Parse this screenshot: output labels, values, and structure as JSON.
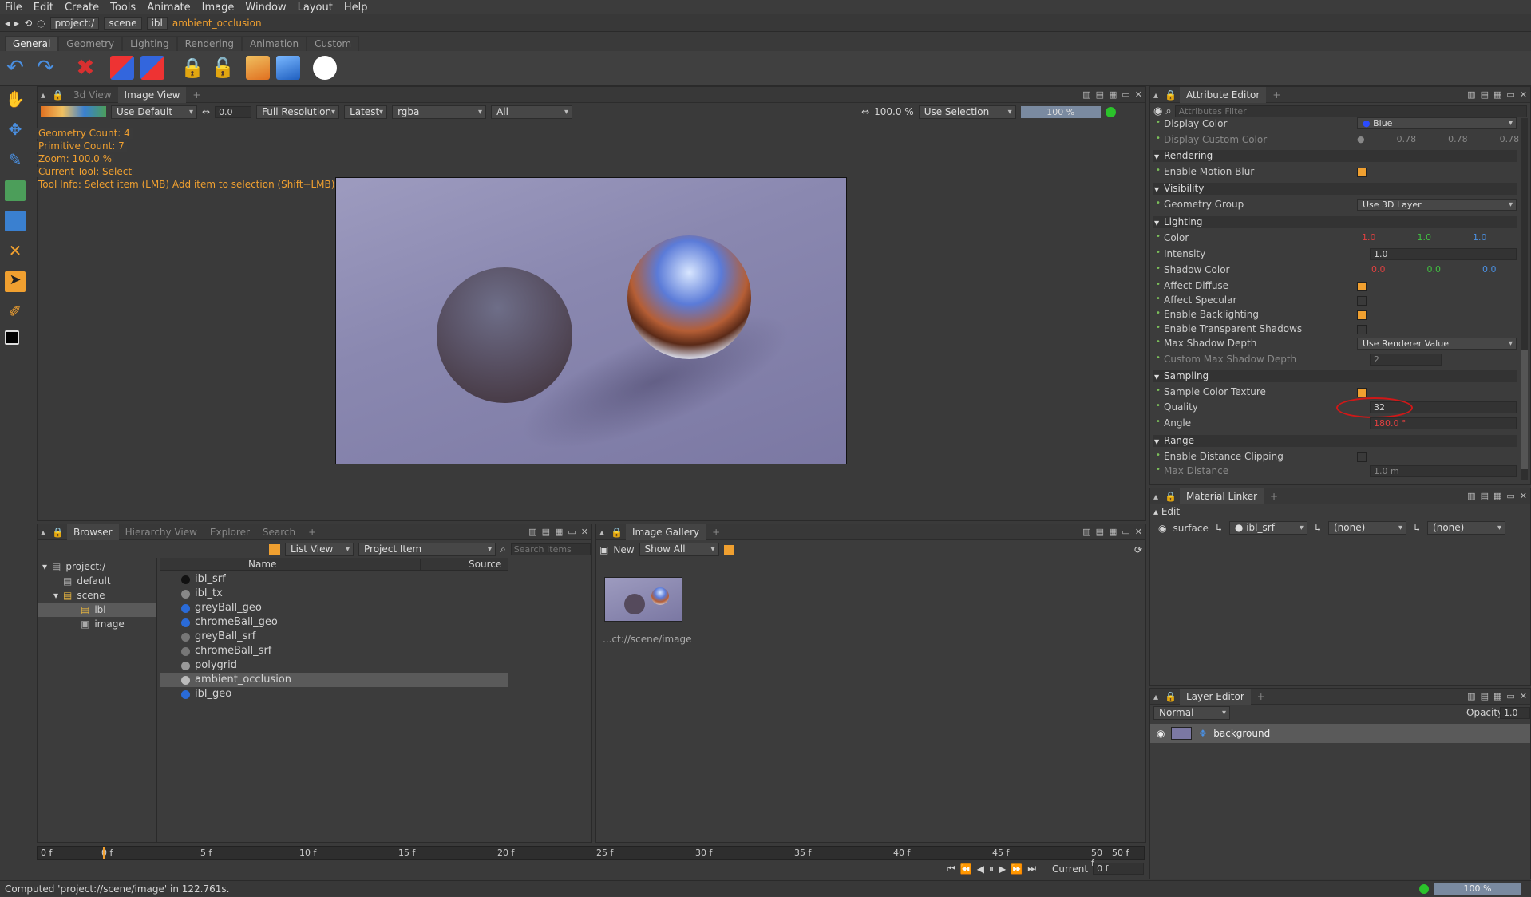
{
  "menu": [
    "File",
    "Edit",
    "Create",
    "Tools",
    "Animate",
    "Image",
    "Window",
    "Layout",
    "Help"
  ],
  "address": {
    "crumbs": [
      "project:/",
      "scene",
      "ibl"
    ],
    "current": "ambient_occlusion"
  },
  "shelf_tabs": [
    {
      "label": "General",
      "active": true
    },
    {
      "label": "Geometry"
    },
    {
      "label": "Lighting"
    },
    {
      "label": "Rendering"
    },
    {
      "label": "Animation"
    },
    {
      "label": "Custom"
    }
  ],
  "viewer": {
    "tabs": [
      "3d View",
      "Image View"
    ],
    "active_tab": "Image View",
    "display": "Use Default",
    "exposure": "0.0",
    "resolution": "Full Resolution",
    "version": "Latest",
    "channels": "rgba",
    "layer": "All",
    "zoom": "100.0 %",
    "selection": "Use Selection",
    "progress": "100 %",
    "progress_value": 100,
    "overlay": [
      "Geometry Count: 4",
      "Primitive Count: 7",
      "Zoom: 100.0 %",
      "Current Tool: Select",
      "Tool Info: Select item (LMB)  Add item to selection (Shift+LMB)  Toggle item selection (Ctrl+LMB)  Selection rect (LMB-Drag)"
    ]
  },
  "attribute_editor": {
    "title": "Attribute Editor",
    "filter_placeholder": "Attributes Filter",
    "display_color": {
      "label": "Display Color",
      "value": "Blue"
    },
    "display_custom_color": {
      "label": "Display Custom Color",
      "values": [
        "0.78",
        "0.78",
        "0.78"
      ]
    },
    "sections": {
      "rendering": "Rendering",
      "visibility": "Visibility",
      "lighting": "Lighting",
      "sampling": "Sampling",
      "range": "Range"
    },
    "enable_motion_blur": "Enable Motion Blur",
    "geometry_group": {
      "label": "Geometry Group",
      "value": "Use 3D Layer"
    },
    "color": {
      "label": "Color",
      "values": [
        "1.0",
        "1.0",
        "1.0"
      ]
    },
    "intensity": {
      "label": "Intensity",
      "value": "1.0"
    },
    "shadow_color": {
      "label": "Shadow Color",
      "values": [
        "0.0",
        "0.0",
        "0.0"
      ]
    },
    "affect_diffuse": "Affect Diffuse",
    "affect_specular": "Affect Specular",
    "enable_backlighting": "Enable Backlighting",
    "enable_transparent_shadows": "Enable Transparent Shadows",
    "max_shadow_depth": {
      "label": "Max Shadow Depth",
      "value": "Use Renderer Value"
    },
    "custom_max_shadow_depth": {
      "label": "Custom Max Shadow Depth",
      "value": "2"
    },
    "sample_color_texture": "Sample Color Texture",
    "quality": {
      "label": "Quality",
      "value": "32"
    },
    "angle": {
      "label": "Angle",
      "value": "180.0 °"
    },
    "enable_distance_clipping": "Enable Distance Clipping",
    "max_distance": {
      "label": "Max Distance",
      "value": "1.0 m"
    }
  },
  "material_linker": {
    "title": "Material Linker",
    "edit": "Edit",
    "surface": "surface",
    "material": "ibl_srf",
    "slot2": "(none)",
    "slot3": "(none)"
  },
  "layer_editor": {
    "title": "Layer Editor",
    "blend": "Normal",
    "opacity_label": "Opacity",
    "opacity": "1.0",
    "layer": "background"
  },
  "browser": {
    "tabs": [
      "Browser",
      "Hierarchy View",
      "Explorer",
      "Search"
    ],
    "view": "List View",
    "filter": "Project Item",
    "search_placeholder": "Search Items",
    "tree": [
      "project:/",
      "default",
      "scene",
      "ibl",
      "image"
    ],
    "columns": [
      "Name",
      "Source"
    ],
    "items": [
      {
        "name": "ibl_srf",
        "color": "#111111"
      },
      {
        "name": "ibl_tx",
        "color": "#888888"
      },
      {
        "name": "greyBall_geo",
        "color": "#2a6bd8"
      },
      {
        "name": "chromeBall_geo",
        "color": "#2a6bd8"
      },
      {
        "name": "greyBall_srf",
        "color": "#777777"
      },
      {
        "name": "chromeBall_srf",
        "color": "#777777"
      },
      {
        "name": "polygrid",
        "color": "#999999"
      },
      {
        "name": "ambient_occlusion",
        "color": "#bbbbbb"
      },
      {
        "name": "ibl_geo",
        "color": "#2a6bd8"
      }
    ]
  },
  "gallery": {
    "title": "Image Gallery",
    "new": "New",
    "filter": "Show All",
    "caption": "...ct://scene/image"
  },
  "timeline": {
    "start": "0 f",
    "ticks": [
      "0 f",
      "5 f",
      "10 f",
      "15 f",
      "20 f",
      "25 f",
      "30 f",
      "35 f",
      "40 f",
      "45 f",
      "50 f"
    ],
    "end": "50 f",
    "current_label": "Current",
    "current": "0 f"
  },
  "status": {
    "message": "Computed 'project://scene/image' in 122.761s.",
    "zoom": "100 %"
  }
}
